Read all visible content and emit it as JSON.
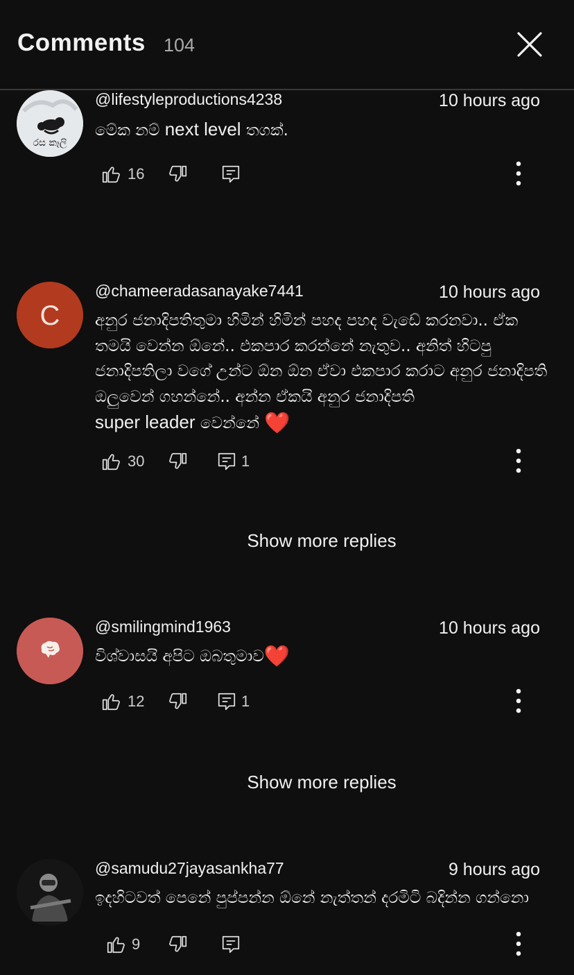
{
  "header": {
    "title": "Comments",
    "count": "104"
  },
  "icons": {
    "like": "thumbs-up-icon",
    "dislike": "thumbs-down-icon",
    "reply": "reply-comment-icon",
    "more": "three-dots-vertical-icon",
    "close": "close-icon"
  },
  "comments": [
    {
      "handle": "@lifestyleproductions4238",
      "time": "10 hours ago",
      "text_pre": "මේක නම් ",
      "text_big": "next level",
      "text_post": " තගක්.",
      "likes": "16",
      "replies": "",
      "avatar_text": "රස කෑලි"
    },
    {
      "handle": "@chameeradasanayake7441",
      "time": "10 hours ago",
      "text": "අනුර ජනාදිපතිතුමා හිමින් හිමින් පහද පහද වැඩේ  කරනවා.. ඒක තමයි වෙන්න ඕනේ.. එකපාර කරන්නේ නැතුව.. අනිත් හිටපු ජනාදිපතිලා වගේ  උන්ට ඕන ඕන ඒවා එකපාර කරාට අනුර ජනාදිපති ඔලුවෙන් ගහන්නේ.. අන්න ඒකයි  අනුර ජනාදිපති",
      "text_big": "super leader",
      "text_post": " වෙන්නේ ",
      "heart": "❤️",
      "likes": "30",
      "replies": "1",
      "avatar_letter": "C",
      "avatar_color": "#b23a1e",
      "show_more": "Show more replies"
    },
    {
      "handle": "@smilingmind1963",
      "time": "10 hours ago",
      "text": "විශ්වාසයි අපිට ඔබතුමාව",
      "heart": "❤️",
      "likes": "12",
      "replies": "1",
      "avatar_color": "#c85a55",
      "show_more": "Show more replies"
    },
    {
      "handle": "@samudu27jayasankha77",
      "time": "9 hours ago",
      "text": "ඉදහිටවත් පෙනේ පුප්පන්න ඕනේ නැත්තන් දරමිටි බදින්න ගන්නො",
      "likes": "9",
      "replies": ""
    }
  ]
}
